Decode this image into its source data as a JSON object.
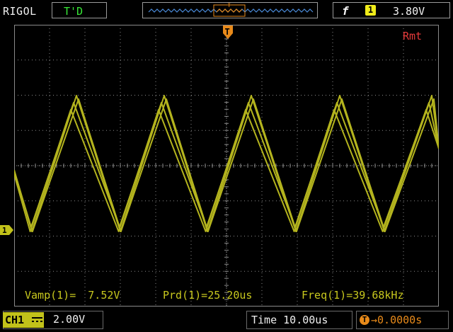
{
  "header": {
    "brand": "RIGOL",
    "run_status": "T'D",
    "trigger": {
      "edge_icon": "rising-edge-icon",
      "edge_glyph": "f",
      "source_channel": "1",
      "level": "3.80V"
    }
  },
  "screen": {
    "remote_indicator": "Rmt",
    "channel_marker": "1",
    "trigger_position_icon": "T",
    "measurements": [
      {
        "label": "Vamp(1)=",
        "value": "7.52V"
      },
      {
        "label": "Prd(1)=",
        "value": "25.20us"
      },
      {
        "label": "Freq(1)=",
        "value": "39.68kHz"
      }
    ]
  },
  "footer": {
    "channel": "CH1",
    "coupling_icon": "dc-coupling-icon",
    "vertical_scale": "2.00V",
    "timebase": "Time 10.00us",
    "trigger_offset_icon": "T",
    "trigger_offset": "→0.0000s"
  },
  "colors": {
    "trace": "#b4b41e",
    "grid": "#8a8a8a",
    "channel": "#c2c21a",
    "trigger": "#e88a1a",
    "status": "#37e637",
    "remote": "#e53a3a"
  }
}
